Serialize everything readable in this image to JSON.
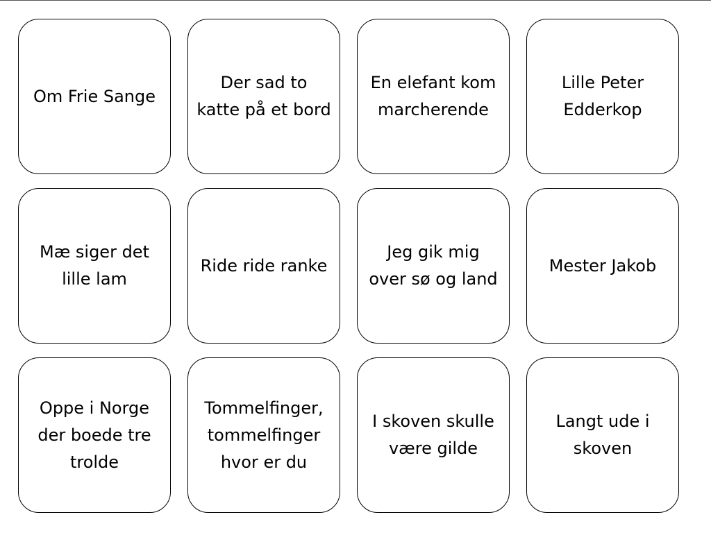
{
  "tiles": [
    {
      "id": "om-frie-sange",
      "label": "Om Frie Sange"
    },
    {
      "id": "der-sad-to-katte",
      "label": "Der sad to katte på et bord"
    },
    {
      "id": "en-elefant-kom",
      "label": "En elefant kom marcherende"
    },
    {
      "id": "lille-peter-edderkop",
      "label": "Lille Peter Edderkop"
    },
    {
      "id": "mae-siger-det-lille-lam",
      "label": "Mæ siger det lille lam"
    },
    {
      "id": "ride-ride-ranke",
      "label": "Ride ride ranke"
    },
    {
      "id": "jeg-gik-mig-over",
      "label": "Jeg gik mig over sø og land"
    },
    {
      "id": "mester-jakob",
      "label": "Mester Jakob"
    },
    {
      "id": "oppe-i-norge",
      "label": "Oppe i Norge der boede tre trolde"
    },
    {
      "id": "tommelfinger",
      "label": "Tommelfinger, tommelfinger hvor er du"
    },
    {
      "id": "i-skoven-skulle",
      "label": "I skoven skulle være gilde"
    },
    {
      "id": "langt-ude-i-skoven",
      "label": "Langt ude i skoven"
    }
  ]
}
